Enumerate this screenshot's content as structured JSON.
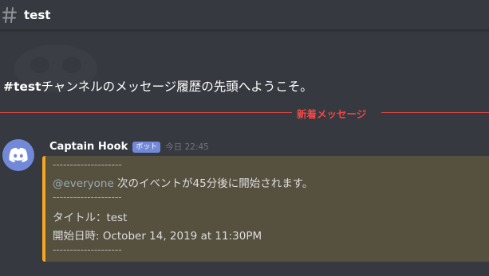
{
  "header": {
    "hash_icon": "hash-icon",
    "channel": "test"
  },
  "welcome": {
    "channel_tag": "#test",
    "text": "チャンネルのメッセージ履歴の先頭へようこそ。"
  },
  "divider": {
    "label": "新着メッセージ"
  },
  "message": {
    "author": "Captain Hook",
    "bot_tag": "ボット",
    "timestamp": "今日 22:45",
    "avatar_icon": "discord-logo-icon",
    "embed": {
      "accent_color": "#f5a623",
      "dashes_1": "--------------------",
      "mention": "@everyone",
      "event_text": " 次のイベントが45分後に開始されます。",
      "dashes_2": "--------------------",
      "title_line": "タイトル：test",
      "start_label": "開始日時",
      "start_value": ": October 14, 2019 at 11:30PM",
      "dashes_3": "--------------------"
    }
  },
  "colors": {
    "background": "#36393f",
    "blurple": "#7289da",
    "new_messages": "#f04747"
  }
}
